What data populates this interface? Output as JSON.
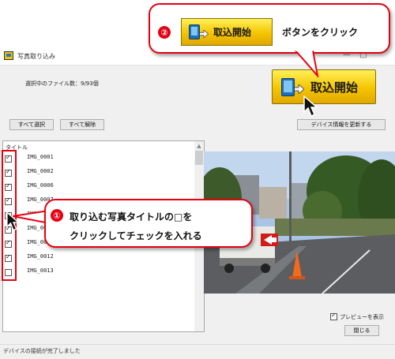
{
  "window": {
    "title": "写真取り込み",
    "minimize_glyph": "—",
    "maximize_glyph": "□",
    "selection_info": "選択中のファイル数：9/93個"
  },
  "toolbar": {
    "select_all": "すべて選択",
    "deselect_all": "すべて解除",
    "refresh_device": "デバイス情報を更新する",
    "import_button": "取込開始"
  },
  "list": {
    "header": "タイトル",
    "items": [
      {
        "label": "IMG_0001",
        "checked": true
      },
      {
        "label": "IMG_0002",
        "checked": true
      },
      {
        "label": "IMG_0006",
        "checked": true
      },
      {
        "label": "IMG_0007",
        "checked": true
      },
      {
        "label": "IMG_0008",
        "checked": true
      },
      {
        "label": "IMG_0009",
        "checked": true
      },
      {
        "label": "IMG_0011",
        "checked": true
      },
      {
        "label": "IMG_0012",
        "checked": true
      },
      {
        "label": "IMG_0013",
        "checked": false
      }
    ]
  },
  "preview": {
    "sign_text": ""
  },
  "bottom": {
    "preview_checkbox_label": "プレビューを表示",
    "preview_checked": true,
    "close_button": "閉じる",
    "status": "デバイスの接続が完了しました"
  },
  "callout_step2": {
    "number": "②",
    "button_label": "取込開始",
    "text": "ボタンをクリック"
  },
  "callout_step1": {
    "number": "①",
    "line1": "取り込む写真タイトルの□を",
    "line2": "クリックしてチェックを入れる"
  },
  "colors": {
    "accent_red": "#e60012",
    "button_yellow": "#f5c400",
    "tablet_blue": "#1f6fb8"
  }
}
